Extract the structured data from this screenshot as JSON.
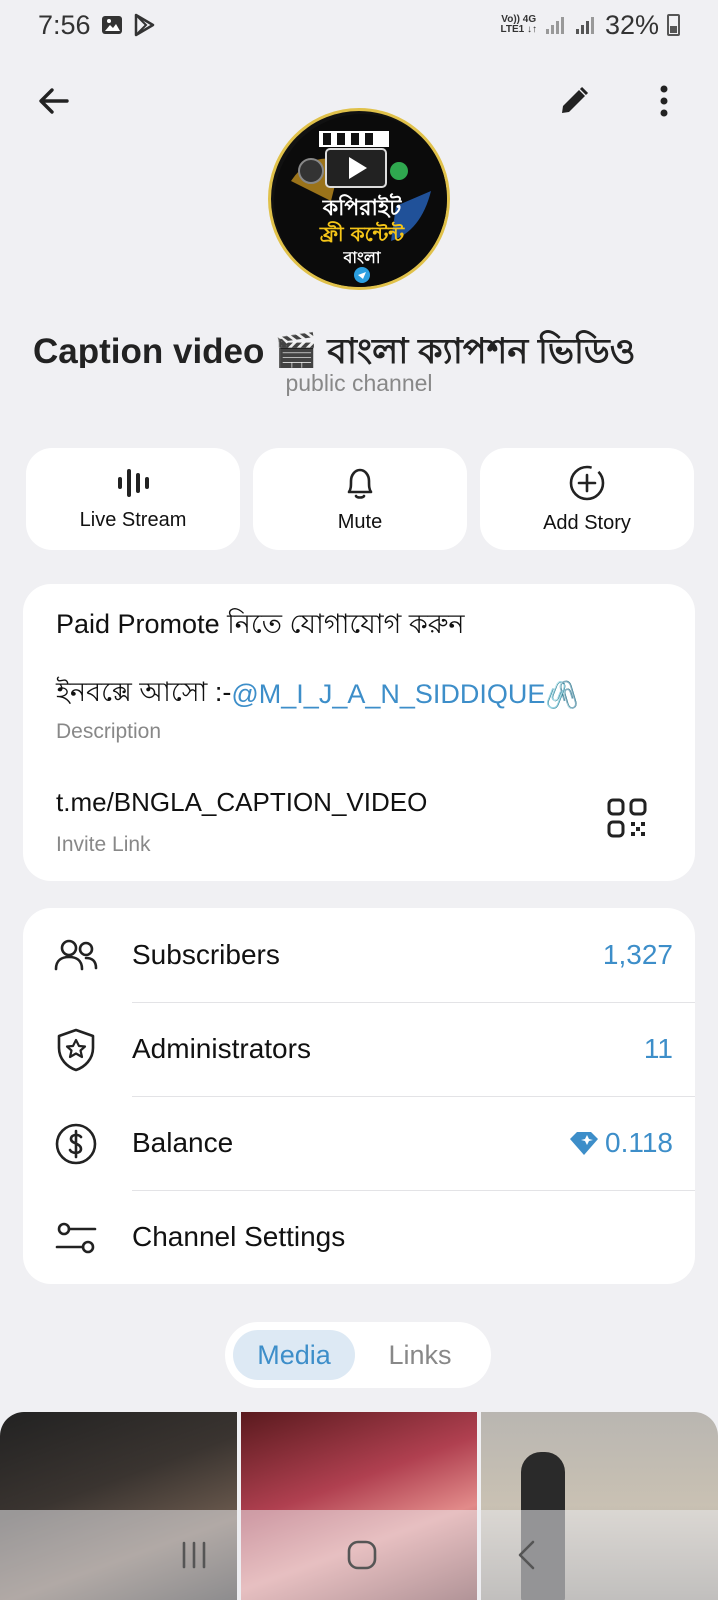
{
  "status_bar": {
    "time": "7:56",
    "network_top": "Vo)) 4G",
    "network_bottom": "LTE1 ↓↑",
    "battery": "32%"
  },
  "channel": {
    "title": "Caption video 🎬   বাংলা ক্যাপশন ভিডিও",
    "subtitle": "public channel",
    "avatar_text": {
      "line1": "কপিরাইট",
      "line2": "ফ্রী কন্টেন্ট",
      "line3": "বাংলা"
    }
  },
  "actions": [
    {
      "label": "Live Stream",
      "icon": "live-stream-icon"
    },
    {
      "label": "Mute",
      "icon": "bell-icon"
    },
    {
      "label": "Add Story",
      "icon": "add-story-icon"
    }
  ],
  "info": {
    "line1": "Paid Promote নিতে যোগাযোগ করুন",
    "line2_prefix": "ইনবক্সে আসো :- ",
    "line2_mention": "@M_I_J_A_N_SIDDIQUE",
    "line2_emoji": "🖇️",
    "description_label": "Description",
    "invite_link": "t.me/BNGLA_CAPTION_VIDEO",
    "invite_label": "Invite Link"
  },
  "stats": [
    {
      "label": "Subscribers",
      "value": "1,327",
      "icon": "subscribers-icon"
    },
    {
      "label": "Administrators",
      "value": "11",
      "icon": "shield-star-icon"
    },
    {
      "label": "Balance",
      "value": "0.118",
      "icon": "dollar-icon"
    },
    {
      "label": "Channel Settings",
      "value": "",
      "icon": "settings-sliders-icon"
    }
  ],
  "tabs": {
    "media": "Media",
    "links": "Links"
  },
  "colors": {
    "accent": "#3d8ec9",
    "background": "#f0f0f3",
    "card": "#ffffff"
  }
}
